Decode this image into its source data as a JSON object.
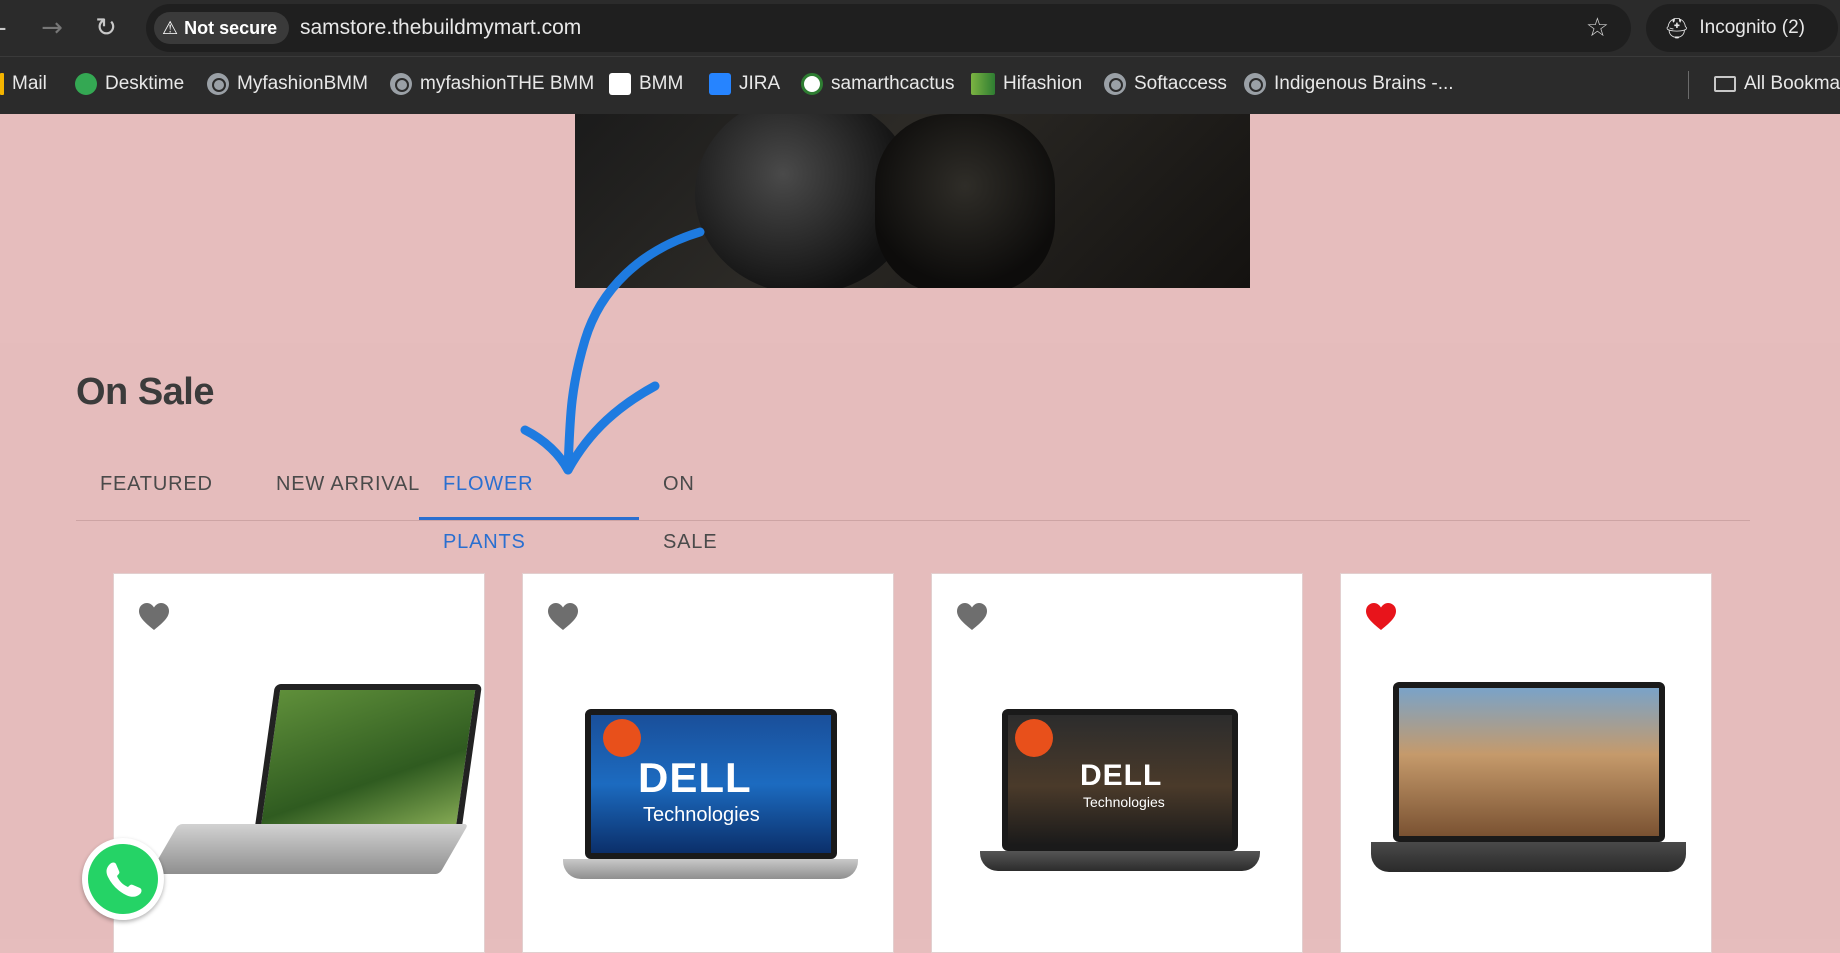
{
  "browser": {
    "security_label": "Not secure",
    "url": "samstore.thebuildmymart.com",
    "incognito_label": "Incognito (2)",
    "bookmarks": [
      {
        "label": "Mail"
      },
      {
        "label": "Desktime"
      },
      {
        "label": "MyfashionBMM"
      },
      {
        "label": "myfashionTHE BMM"
      },
      {
        "label": "BMM"
      },
      {
        "label": "JIRA"
      },
      {
        "label": "samarthcactus"
      },
      {
        "label": "Hifashion"
      },
      {
        "label": "Softaccess"
      },
      {
        "label": "Indigenous Brains -..."
      },
      {
        "label": "All Bookma"
      }
    ]
  },
  "section": {
    "title": "On Sale",
    "tabs": [
      {
        "label": "FEATURED",
        "active": false
      },
      {
        "label": "NEW ARRIVAL",
        "active": false
      },
      {
        "label": "FLOWER PLANTS",
        "active": true
      },
      {
        "label": "ON SALE",
        "active": false
      }
    ]
  },
  "products": [
    {
      "wishlisted": false
    },
    {
      "wishlisted": false,
      "brand": "DELL",
      "brand_sub": "Technologies"
    },
    {
      "wishlisted": false,
      "brand": "DELL",
      "brand_sub": "Technologies"
    },
    {
      "wishlisted": true
    }
  ],
  "colors": {
    "accent": "#2a6fd0",
    "heart_default": "#6e6e6e",
    "heart_active": "#e8141b",
    "page_bg": "#e6bdbd"
  }
}
